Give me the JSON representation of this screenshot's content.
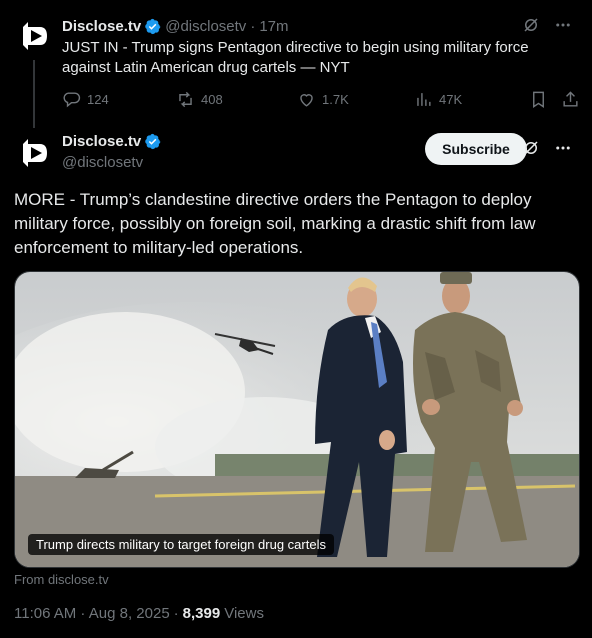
{
  "reply_tweet": {
    "name": "Disclose.tv",
    "handle": "@disclosetv",
    "separator": "·",
    "time": "17m",
    "text": "JUST IN - Trump signs Pentagon directive to begin using military force against Latin American drug cartels — NYT",
    "actions": {
      "replies": "124",
      "reposts": "408",
      "likes": "1.7K",
      "views": "47K"
    }
  },
  "main_tweet": {
    "name": "Disclose.tv",
    "handle": "@disclosetv",
    "subscribe_label": "Subscribe",
    "text": "MORE - Trump’s clandestine directive orders the Pentagon to deploy military force, possibly on foreign soil, marking a drastic shift from law enforcement to military-led operations.",
    "media_caption": "Trump directs military to target foreign drug cartels",
    "source": "From disclose.tv",
    "timestamp": "11:06 AM · Aug 8, 2025",
    "meta_separator": "·",
    "views_count": "8,399",
    "views_label": "Views"
  },
  "colors": {
    "background": "#000000",
    "text_primary": "#e7e9ea",
    "text_secondary": "#71767b",
    "verified_blue": "#1d9bf0",
    "subscribe_bg": "#eff3f4"
  },
  "icons": [
    "disclose-logo",
    "verified-badge-icon",
    "grok-icon",
    "more-icon",
    "reply-icon",
    "repost-icon",
    "like-icon",
    "views-icon",
    "bookmark-icon",
    "share-icon"
  ]
}
